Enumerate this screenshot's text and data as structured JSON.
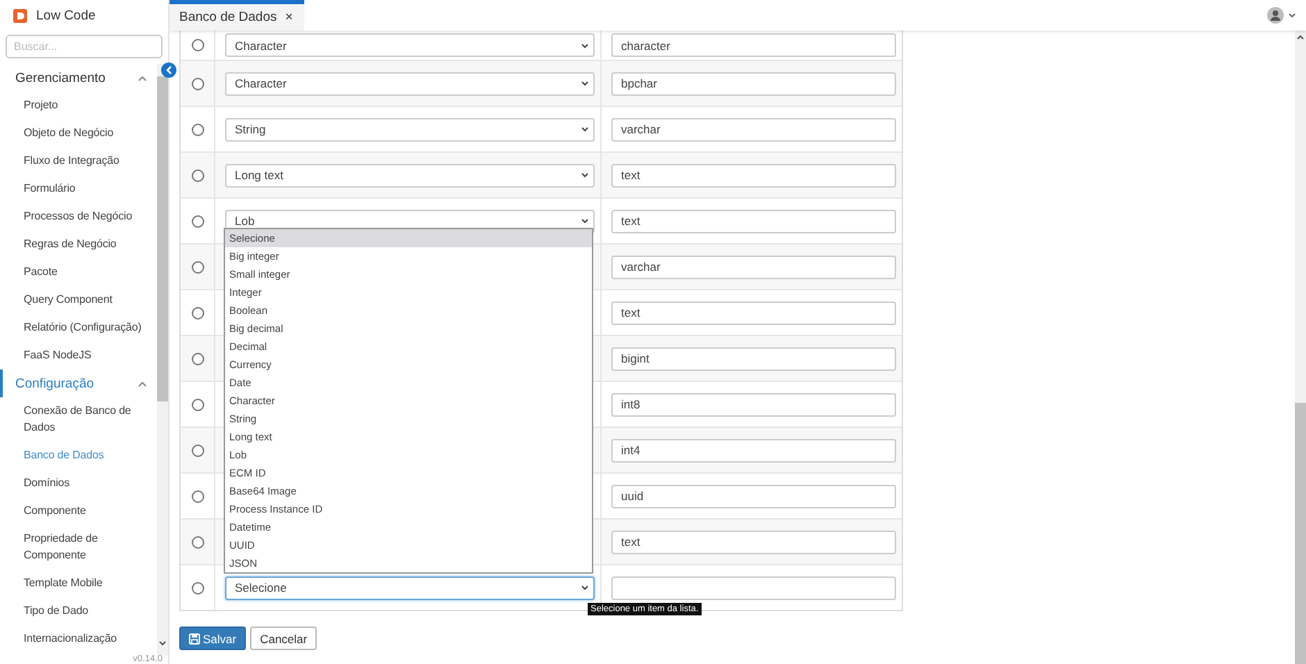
{
  "app": {
    "name": "Low Code",
    "search_placeholder": "Buscar...",
    "version": "v0.14.0"
  },
  "sidebar": {
    "groups": [
      {
        "label": "Gerenciamento",
        "expanded": true,
        "active": false,
        "items": [
          {
            "label": "Projeto",
            "selected": false
          },
          {
            "label": "Objeto de Negócio",
            "selected": false
          },
          {
            "label": "Fluxo de Integração",
            "selected": false
          },
          {
            "label": "Formulário",
            "selected": false
          },
          {
            "label": "Processos de Negócio",
            "selected": false
          },
          {
            "label": "Regras de Negócio",
            "selected": false
          },
          {
            "label": "Pacote",
            "selected": false
          },
          {
            "label": "Query Component",
            "selected": false
          },
          {
            "label": "Relatório (Configuração)",
            "selected": false
          },
          {
            "label": "FaaS NodeJS",
            "selected": false
          }
        ]
      },
      {
        "label": "Configuração",
        "expanded": true,
        "active": true,
        "items": [
          {
            "label": "Conexão de Banco de Dados",
            "selected": false
          },
          {
            "label": "Banco de Dados",
            "selected": true
          },
          {
            "label": "Domínios",
            "selected": false
          },
          {
            "label": "Componente",
            "selected": false
          },
          {
            "label": "Propriedade de Componente",
            "selected": false
          },
          {
            "label": "Template Mobile",
            "selected": false
          },
          {
            "label": "Tipo de Dado",
            "selected": false
          },
          {
            "label": "Internacionalização",
            "selected": false
          }
        ]
      }
    ]
  },
  "tabs": [
    {
      "label": "Banco de Dados",
      "close": "×",
      "selected": true
    }
  ],
  "table": {
    "rows": [
      {
        "selected": false,
        "type": "Character",
        "db_type": "character"
      },
      {
        "selected": false,
        "type": "Character",
        "db_type": "bpchar"
      },
      {
        "selected": false,
        "type": "String",
        "db_type": "varchar"
      },
      {
        "selected": false,
        "type": "Long text",
        "db_type": "text"
      },
      {
        "selected": false,
        "type": "Lob",
        "db_type": "text"
      },
      {
        "selected": false,
        "db_type": "varchar"
      },
      {
        "selected": false,
        "db_type": "text"
      },
      {
        "selected": false,
        "db_type": "bigint"
      },
      {
        "selected": false,
        "db_type": "int8"
      },
      {
        "selected": false,
        "db_type": "int4"
      },
      {
        "selected": false,
        "db_type": "uuid"
      },
      {
        "selected": false,
        "db_type": "text"
      },
      {
        "selected": false,
        "type": "Selecione",
        "focused": true
      }
    ]
  },
  "dropdown": {
    "options": [
      {
        "label": "Selecione",
        "selected": true
      },
      {
        "label": "Big integer",
        "selected": false
      },
      {
        "label": "Small integer",
        "selected": false
      },
      {
        "label": "Integer",
        "selected": false
      },
      {
        "label": "Boolean",
        "selected": false
      },
      {
        "label": "Big decimal",
        "selected": false
      },
      {
        "label": "Decimal",
        "selected": false
      },
      {
        "label": "Currency",
        "selected": false
      },
      {
        "label": "Date",
        "selected": false
      },
      {
        "label": "Character",
        "selected": false
      },
      {
        "label": "String",
        "selected": false
      },
      {
        "label": "Long text",
        "selected": false
      },
      {
        "label": "Lob",
        "selected": false
      },
      {
        "label": "ECM ID",
        "selected": false
      },
      {
        "label": "Base64 Image",
        "selected": false
      },
      {
        "label": "Process Instance ID",
        "selected": false
      },
      {
        "label": "Datetime",
        "selected": false
      },
      {
        "label": "UUID",
        "selected": false
      },
      {
        "label": "JSON",
        "selected": false
      }
    ]
  },
  "tooltip": "Selecione um item da lista.",
  "buttons": [
    {
      "label": "Salvar",
      "kind": "primary"
    },
    {
      "label": "Cancelar",
      "kind": "secondary"
    }
  ]
}
